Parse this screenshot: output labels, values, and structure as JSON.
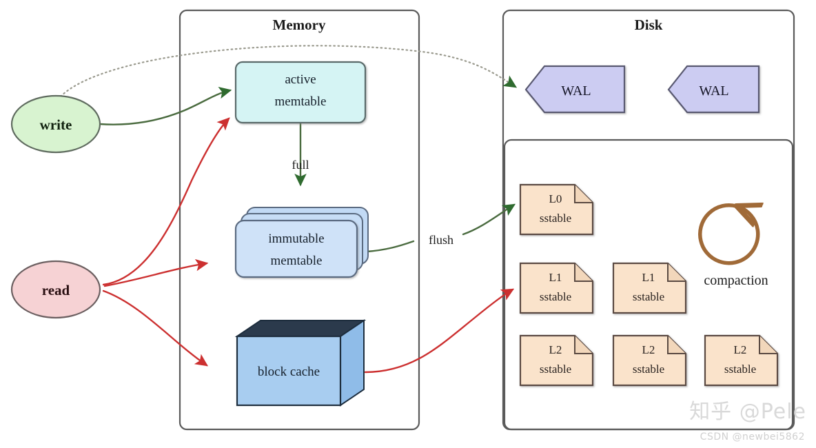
{
  "containers": {
    "memory": {
      "title": "Memory"
    },
    "disk": {
      "title": "Disk"
    }
  },
  "sources": {
    "write": {
      "label": "write",
      "fill": "#d8f3d0",
      "stroke": "#5f6b5f"
    },
    "read": {
      "label": "read",
      "fill": "#f6d2d4",
      "stroke": "#6b5f60"
    }
  },
  "memory_nodes": {
    "active_memtable": {
      "line1": "active",
      "line2": "memtable",
      "fill": "#d5f4f4",
      "stroke": "#5a6a6a"
    },
    "immutable_memtable": {
      "line1": "immutable",
      "line2": "memtable",
      "fill": "#c2daf5",
      "stroke": "#5a6a80"
    },
    "block_cache": {
      "label": "block cache",
      "fill": "#a8cdf0",
      "stroke": "#1d2d3d"
    }
  },
  "disk_nodes": {
    "wal": [
      {
        "label": "WAL",
        "fill": "#ccccf2",
        "stroke": "#585870"
      },
      {
        "label": "WAL",
        "fill": "#ccccf2",
        "stroke": "#585870"
      }
    ],
    "sstables": [
      {
        "level": "L0",
        "kind": "sstable",
        "row": 0,
        "col": 0
      },
      {
        "level": "L1",
        "kind": "sstable",
        "row": 1,
        "col": 0
      },
      {
        "level": "L1",
        "kind": "sstable",
        "row": 1,
        "col": 1
      },
      {
        "level": "L2",
        "kind": "sstable",
        "row": 2,
        "col": 0
      },
      {
        "level": "L2",
        "kind": "sstable",
        "row": 2,
        "col": 1
      },
      {
        "level": "L2",
        "kind": "sstable",
        "row": 2,
        "col": 2
      }
    ],
    "sstable_fill": "#fae3cb",
    "sstable_stroke": "#5a4a42",
    "compaction": {
      "label": "compaction",
      "color": "#a06a38"
    }
  },
  "edges": {
    "write_to_wal": {
      "label": "",
      "style": "dotted",
      "color": "#9a9a8e"
    },
    "write_to_active": {
      "label": "",
      "style": "solid",
      "color": "#4a6b3f"
    },
    "active_to_immutable": {
      "label": "full",
      "style": "solid",
      "color": "#4a6b3f"
    },
    "immutable_to_l0": {
      "label": "flush",
      "style": "solid",
      "color": "#4a6b3f"
    },
    "read_to_active": {
      "label": "",
      "style": "solid",
      "color": "#cc4545"
    },
    "read_to_immutable": {
      "label": "",
      "style": "solid",
      "color": "#cc4545"
    },
    "read_to_block_cache": {
      "label": "",
      "style": "solid",
      "color": "#cc4545"
    },
    "block_cache_to_l1": {
      "label": "",
      "style": "solid",
      "color": "#cc4545"
    }
  },
  "watermarks": {
    "zhihu": "知乎 @Pele",
    "csdn": "CSDN @newbei5862"
  },
  "colors": {
    "container_stroke": "#5a5a5a",
    "arrow_green": "#2f6b2f",
    "arrow_red": "#cc3030",
    "arrow_dotted": "#9a9a8e"
  }
}
